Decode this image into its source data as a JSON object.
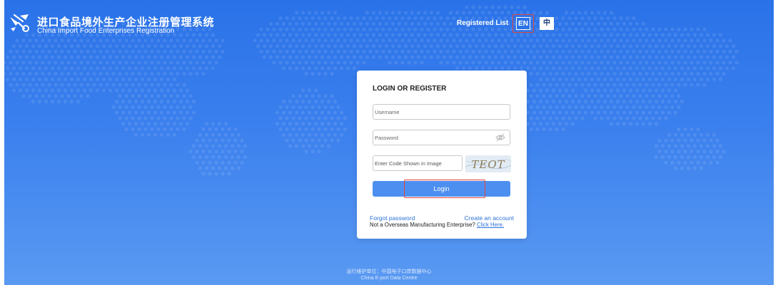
{
  "header": {
    "title_cn": "进口食品境外生产企业注册管理系统",
    "title_en": "China Import Food Enterprises Registration",
    "registered_list": "Registered List",
    "lang_en": "EN",
    "lang_zh": "中"
  },
  "login": {
    "title": "LOGIN OR REGISTER",
    "username_placeholder": "Username",
    "password_placeholder": "Password",
    "code_placeholder": "Enter Code Shown in Image",
    "captcha_text": "TEOT",
    "login_button": "Login",
    "forgot_password": "Forgot password",
    "create_account": "Create an account",
    "notice_text": "Not a Overseas Manufacturing Enterprise? ",
    "notice_link": "Click Here."
  },
  "footer": {
    "line_cn": "运行维护单位：中国电子口岸数据中心",
    "line_en": "China E-port Data Centre"
  },
  "colors": {
    "background_top": "#2a72e8",
    "background_bottom": "#5a9af2",
    "primary_button": "#4d8ff0",
    "link": "#2a72d8",
    "highlight": "#e0463c"
  }
}
